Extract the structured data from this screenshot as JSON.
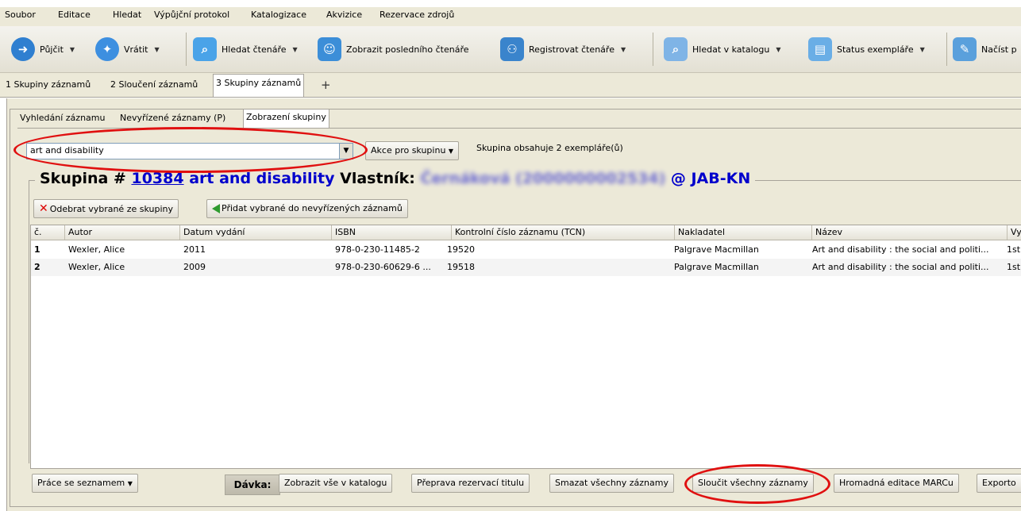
{
  "menu": [
    "Soubor",
    "Editace",
    "Hledat",
    "Výpůjční protokol",
    "Katalogizace",
    "Akvizice",
    "Rezervace zdrojů"
  ],
  "toolbar": {
    "pujcit": "Půjčit",
    "vratit": "Vrátit",
    "hledat_ctenare": "Hledat čtenáře",
    "zobrazit_posledniho": "Zobrazit posledního čtenáře",
    "registrovat": "Registrovat čtenáře",
    "hledat_katalog": "Hledat v katalogu",
    "status": "Status exempláře",
    "nacist": "Načíst p"
  },
  "top_tabs": [
    "1 Skupiny záznamů",
    "2 Sloučení záznamů",
    "3 Skupiny záznamů"
  ],
  "sub_tabs": [
    "Vyhledání záznamu",
    "Nevyřízené záznamy (P)",
    "Zobrazení skupiny"
  ],
  "group_select": {
    "value": "art and disability"
  },
  "akce_button": "Akce pro skupinu",
  "group_status": "Skupina obsahuje 2 exempláře(ů)",
  "group_title": {
    "prefix": "Skupina #",
    "number": "10384",
    "name": "art and disability",
    "owner_label": "Vlastník:",
    "owner": "Černáková (2000000002534)",
    "library": "@ JAB-KN"
  },
  "buttons": {
    "remove": "Odebrat vybrané ze skupiny",
    "add_pending": "Přidat vybrané do nevyřízených záznamů"
  },
  "table": {
    "headers": [
      "č.",
      "Autor",
      "Datum vydání",
      "ISBN",
      "Kontrolní číslo záznamu (TCN)",
      "Nakladatel",
      "Název",
      "Vy"
    ],
    "rows": [
      [
        "1",
        "Wexler, Alice",
        "2011",
        "978-0-230-11485-2",
        "19520",
        "Palgrave Macmillan",
        "Art and disability : the social and politi...",
        "1st"
      ],
      [
        "2",
        "Wexler, Alice",
        "2009",
        "978-0-230-60629-6 ...",
        "19518",
        "Palgrave Macmillan",
        "Art and disability : the social and politi...",
        "1st"
      ]
    ]
  },
  "bottom": {
    "prace": "Práce se seznamem",
    "davka": "Dávka:",
    "zobrazit_vse": "Zobrazit vše v katalogu",
    "preprava": "Přeprava rezervací titulu",
    "smazat": "Smazat všechny záznamy",
    "sloucit": "Sloučit všechny záznamy",
    "hromadna": "Hromadná editace MARCu",
    "export": "Exporto"
  },
  "colors": {
    "link_blue": "#0000cc",
    "annotation_red": "#e01010"
  }
}
